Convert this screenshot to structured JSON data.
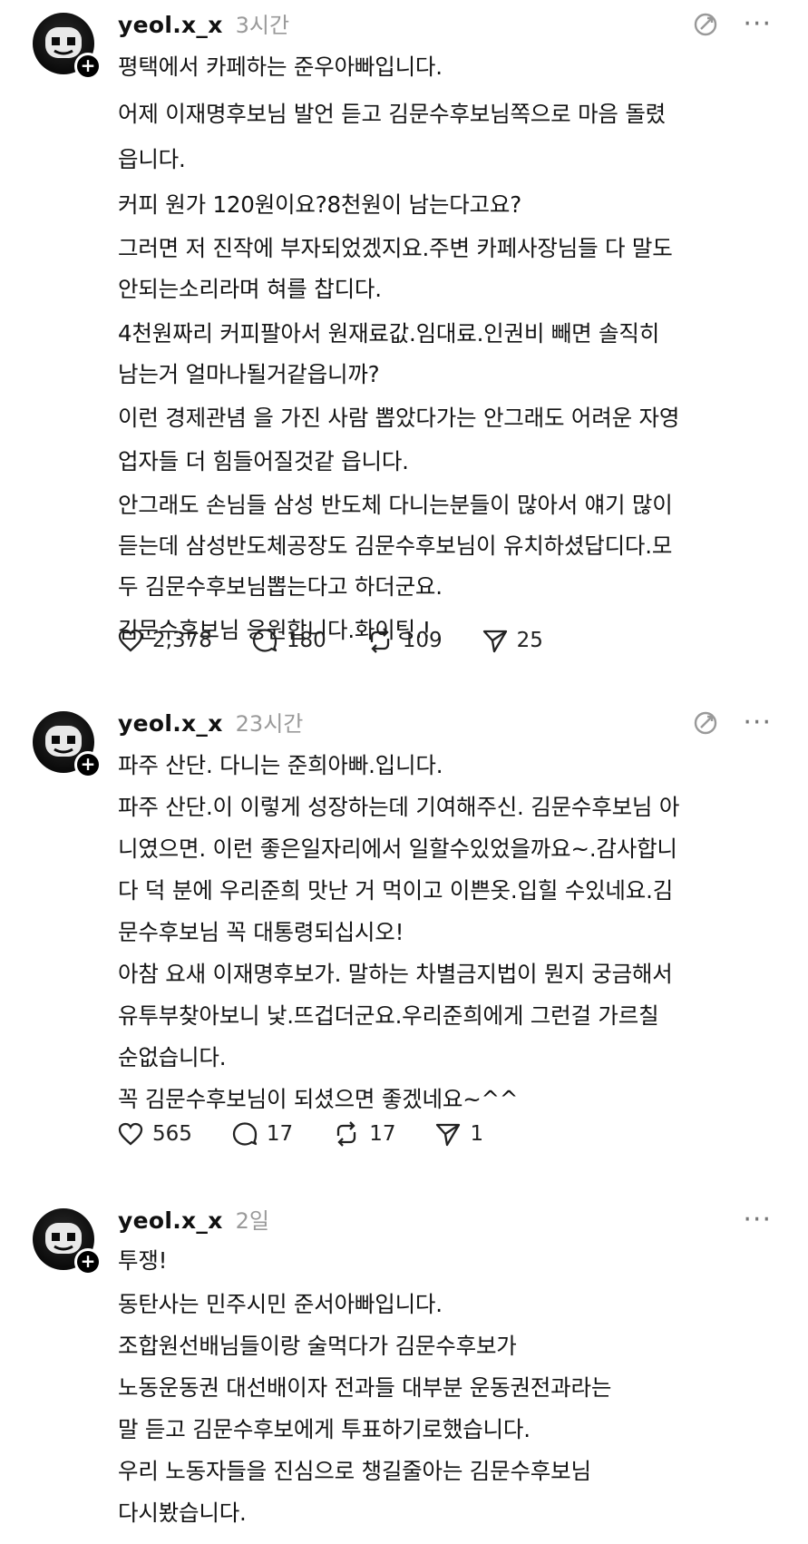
{
  "posts": [
    {
      "username": "yeol.x_x",
      "timestamp": "3시간",
      "lines": [
        "평택에서 카페하는 준우아빠입니다.",
        "어제 이재명후보님 발언 듣고 김문수후보님쪽으로 마음 돌렸",
        "읍니다.",
        "커피 원가 120원이요?8천원이 남는다고요?",
        "그러면 저 진작에 부자되었겠지요.주변 카페사장님들 다 말도",
        "안되는소리라며 혀를 찹디다.",
        "4천원짜리 커피팔아서 원재료값.임대료.인권비 빼면 솔직히",
        "남는거 얼마나될거같읍니까?",
        "이런 경제관념 을 가진 사람 뽑았다가는 안그래도 어려운 자영",
        "업자들 더 힘들어질것같 읍니다.",
        "안그래도 손님들 삼성 반도체 다니는분들이 많아서 얘기 많이",
        "듣는데 삼성반도체공장도 김문수후보님이 유치하셨답디다.모",
        "두 김문수후보님뽑는다고 하더군요.",
        "김문수후보님 응원합니다.화이팅.!"
      ],
      "likes": "2,378",
      "replies": "180",
      "reposts": "109",
      "shares": "25"
    },
    {
      "username": "yeol.x_x",
      "timestamp": "23시간",
      "lines": [
        "파주 산단. 다니는 준희아빠.입니다.",
        "파주 산단.이 이렇게 성장하는데 기여해주신. 김문수후보님 아",
        "니였으면. 이런 좋은일자리에서 일할수있었을까요~.감사합니",
        "다 덕 분에 우리준희 맛난 거 먹이고 이쁜옷.입힐 수있네요.김",
        "문수후보님 꼭 대통령되십시오!",
        "아참 요새 이재명후보가. 말하는 차별금지법이 뭔지 궁금해서",
        "유투부찾아보니 낯.뜨겁더군요.우리준희에게 그런걸 가르칠",
        "순없습니다.",
        "꼭 김문수후보님이 되셨으면 좋겠네요~^^"
      ],
      "likes": "565",
      "replies": "17",
      "reposts": "17",
      "shares": "1"
    },
    {
      "username": "yeol.x_x",
      "timestamp": "2일",
      "lines": [
        "투쟁!",
        "동탄사는 민주시민 준서아빠입니다.",
        "조합원선배님들이랑 술먹다가 김문수후보가",
        "노동운동권 대선배이자 전과들 대부분 운동권전과라는",
        "말 듣고 김문수후보에게 투표하기로했습니다.",
        "우리 노동자들을 진심으로 챙길줄아는 김문수후보님",
        "다시봤습니다."
      ]
    }
  ],
  "icons": {
    "more": "more-dots-icon",
    "translate": "translate-icon",
    "like": "heart-icon",
    "reply": "reply-bubble-icon",
    "repost": "repost-icon",
    "share": "send-icon"
  }
}
